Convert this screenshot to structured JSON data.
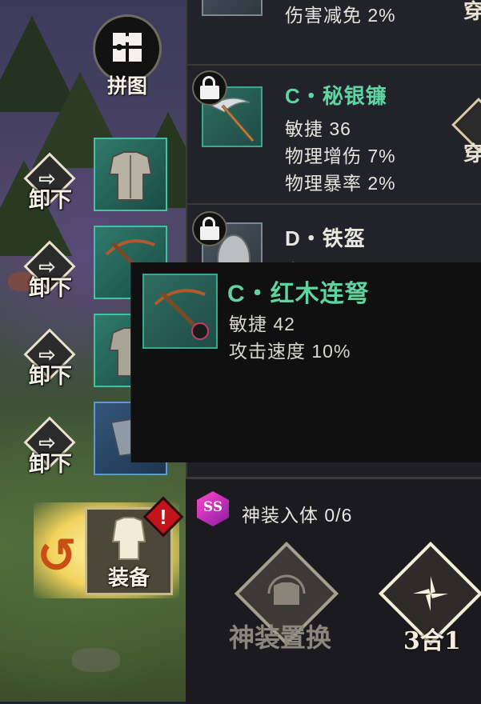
{
  "left": {
    "puzzle": {
      "label": "拼图",
      "icon": "puzzle-icon"
    },
    "unequip_label": "卸下",
    "equip": {
      "label": "装备",
      "alert": "!",
      "icon": "armor-icon"
    },
    "slots": [
      {
        "icon": "chest-armor-icon",
        "rarity_color": "#3fc4a2"
      },
      {
        "icon": "crossbow-icon",
        "rarity_color": "#3fc4a2"
      },
      {
        "icon": "chest-armor-icon",
        "rarity_color": "#3fc4a2"
      },
      {
        "icon": "gauntlet-icon",
        "rarity_color": "#5b9ad6"
      }
    ]
  },
  "list": {
    "top_partial_stat": "伤害减免 2%",
    "side_button_char": "穿",
    "items": [
      {
        "title": "C・秘银镰",
        "stats": [
          "敏捷 36",
          "物理增伤 7%",
          "物理暴率 2%"
        ],
        "icon": "scythe-icon",
        "rarity_color": "#5fd3a0"
      },
      {
        "title": "D・铁盔",
        "partial_stat": "力量 15",
        "icon": "helmet-icon",
        "rarity_color": "#e8e6df"
      }
    ]
  },
  "tooltip": {
    "title": "C・红木连弩",
    "stats": [
      "敏捷 42",
      "攻击速度 10%"
    ],
    "icon": "crossbow-icon"
  },
  "bottom": {
    "badge": "SS",
    "god_equip_text": "神装入体 0/6",
    "swap_label": "神装置换",
    "merge_label": "3合1"
  }
}
